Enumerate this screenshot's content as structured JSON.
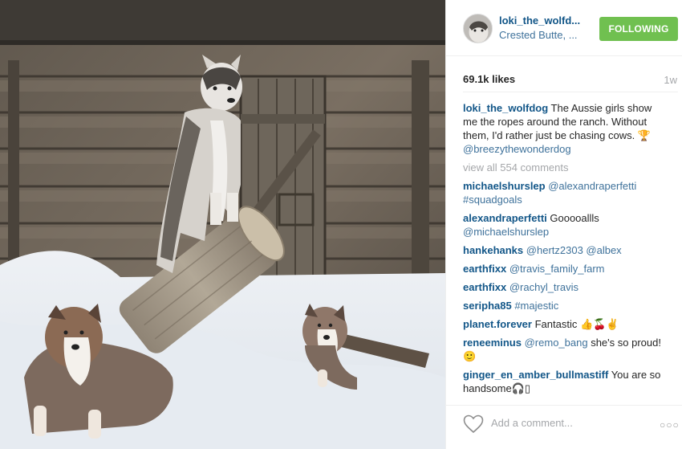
{
  "post": {
    "username": "loki_the_wolfd...",
    "location": "Crested Butte, ...",
    "follow_label": "FOLLOWING",
    "likes": "69.1k likes",
    "age": "1w",
    "caption": {
      "user": "loki_the_wolfdog",
      "text": " The Aussie girls show me the ropes around the ranch. Without them, I'd rather just be chasing cows. ",
      "emoji": "🏆",
      "mention": "@breezythewonderdog"
    },
    "view_all": "view all 554 comments",
    "add_comment_placeholder": "Add a comment...",
    "more_label": "○○○"
  },
  "comments": [
    {
      "user": "michaelshurslep",
      "text": "",
      "mention": "@alexandraperfetti #squadgoals"
    },
    {
      "user": "alexandraperfetti",
      "text": " Gooooallls ",
      "mention": "@michaelshurslep"
    },
    {
      "user": "hankehanks",
      "text": " ",
      "mention": "@hertz2303 @albex"
    },
    {
      "user": "earthfixx",
      "text": " ",
      "mention": "@travis_family_farm"
    },
    {
      "user": "earthfixx",
      "text": " ",
      "mention": "@rachyl_travis"
    },
    {
      "user": "seripha85",
      "text": " ",
      "mention": "#majestic"
    },
    {
      "user": "planet.forever",
      "text": " Fantastic 👍🍒✌",
      "mention": ""
    },
    {
      "user": "reneeminus",
      "text": " ",
      "mention": "@remo_bang",
      "tail": " she's so proud! 🙂"
    },
    {
      "user": "ginger_en_amber_bullmastiff",
      "text": " You are so handsome🎧▯",
      "mention": ""
    }
  ],
  "colors": {
    "username": "#125688",
    "link": "#3f729b",
    "follow_button": "#70c050",
    "muted": "#a5a7aa"
  },
  "icons": [
    "heart-icon",
    "more-options-icon",
    "avatar"
  ]
}
